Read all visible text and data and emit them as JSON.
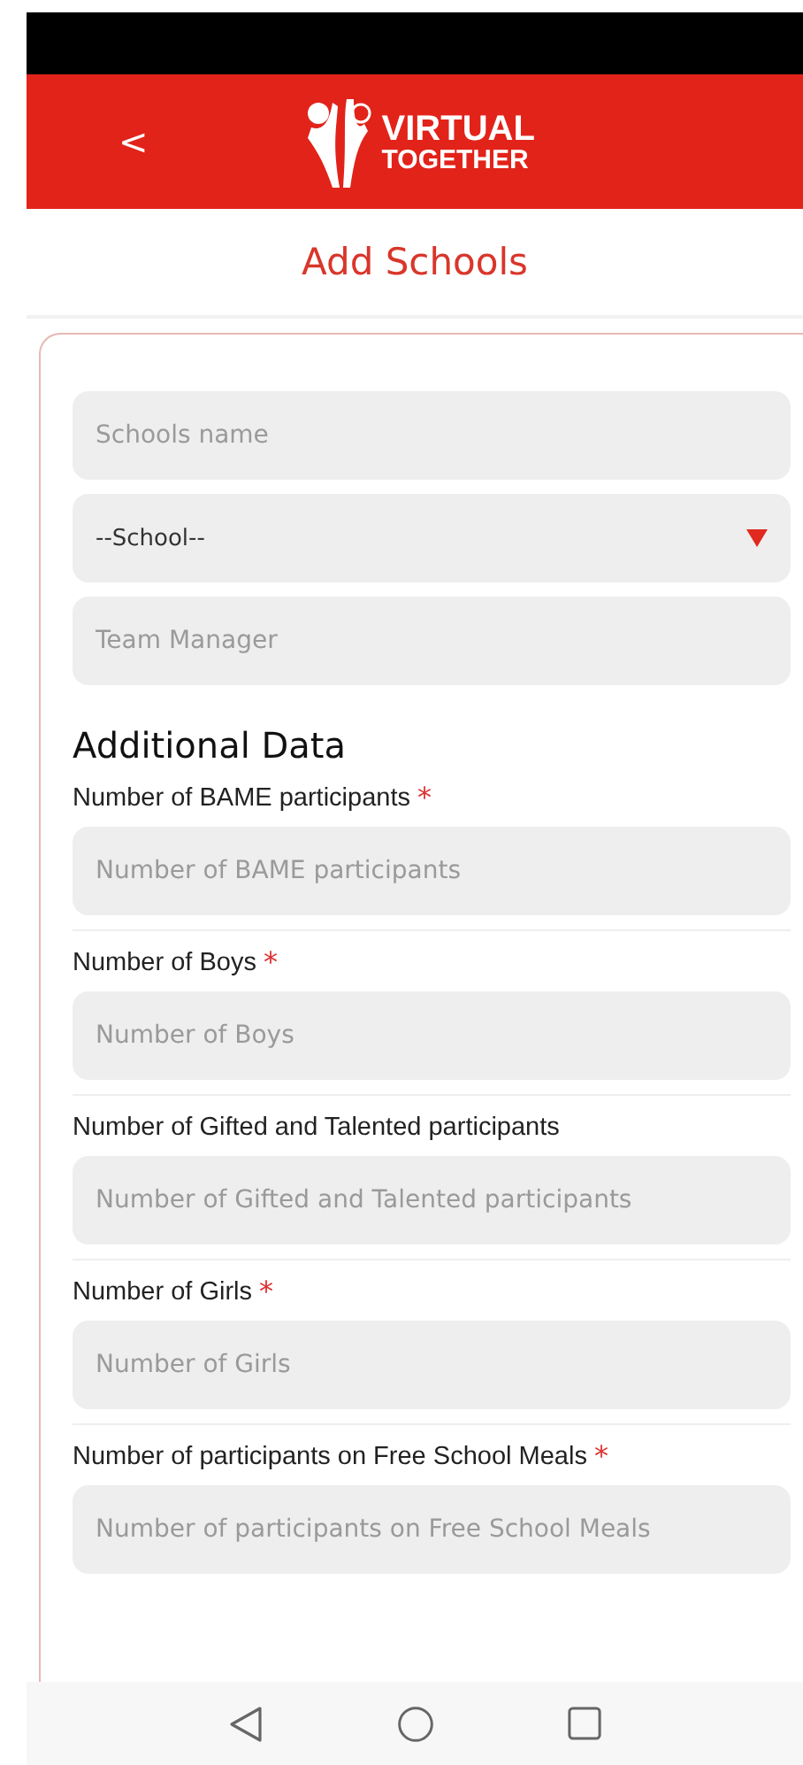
{
  "header": {
    "back": "<",
    "logo": {
      "line_1": "VIRTUAL",
      "line_2": "TOGETHER"
    }
  },
  "title": "Add Schools",
  "fields": [
    {
      "kind": "input",
      "placeholder": "Schools name"
    },
    {
      "kind": "select",
      "value": "--School--"
    },
    {
      "kind": "input",
      "placeholder": "Team Manager"
    }
  ],
  "section_title": "Additional Data",
  "questions": [
    {
      "label": "Number of BAME participants",
      "required_mark": "*",
      "placeholder": "Number of BAME participants"
    },
    {
      "label": "Number of Boys",
      "required_mark": "*",
      "placeholder": "Number of Boys"
    },
    {
      "label": "Number of Gifted and Talented participants",
      "placeholder": "Number of Gifted and Talented participants"
    },
    {
      "label": "Number of Girls",
      "required_mark": "*",
      "placeholder": "Number of Girls"
    },
    {
      "label": "Number of participants on Free School Meals",
      "required_mark": "*",
      "placeholder": "Number of participants on Free School Meals"
    }
  ]
}
